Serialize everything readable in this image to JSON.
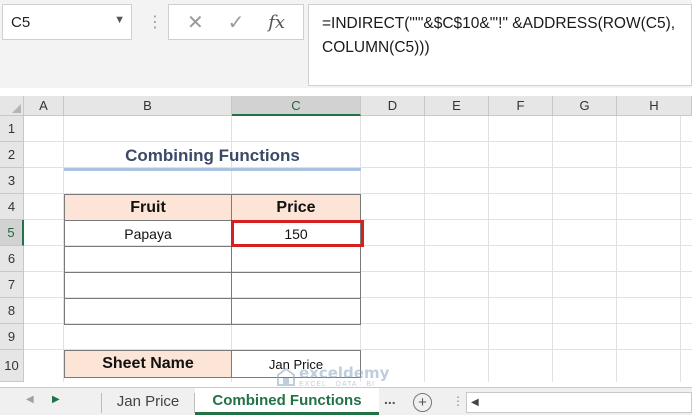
{
  "formula_bar": {
    "name_box": "C5",
    "cancel_icon": "x-icon",
    "enter_icon": "check-icon",
    "function_icon": "fx",
    "formula_line1": "=INDIRECT(\"'\"&$C$10&\"'!\" &ADDRESS(ROW(C5),",
    "formula_line2": "COLUMN(C5)))"
  },
  "columns": [
    "A",
    "B",
    "C",
    "D",
    "E",
    "F",
    "G",
    "H"
  ],
  "selected_column": "C",
  "rows": [
    "1",
    "2",
    "3",
    "4",
    "5",
    "6",
    "7",
    "8",
    "9",
    "10"
  ],
  "selected_row": "5",
  "sheet": {
    "title": "Combining Functions",
    "table_headers": [
      "Fruit",
      "Price"
    ],
    "table_rows": [
      [
        "Papaya",
        "150"
      ],
      [
        "",
        ""
      ],
      [
        "",
        ""
      ],
      [
        "",
        ""
      ]
    ],
    "sheet_name_label": "Sheet Name",
    "sheet_name_value": "Jan Price"
  },
  "tabs": {
    "items": [
      "Jan Price",
      "Combined Functions"
    ],
    "active": "Combined Functions",
    "more_label": "...",
    "add_label": "+"
  },
  "watermark": {
    "brand": "exceldemy",
    "tagline": "EXCEL · DATA · BI"
  },
  "colors": {
    "accent": "#217346",
    "header_fill": "#fce4d6",
    "title_color": "#3a4a66",
    "highlight": "#d42020"
  }
}
